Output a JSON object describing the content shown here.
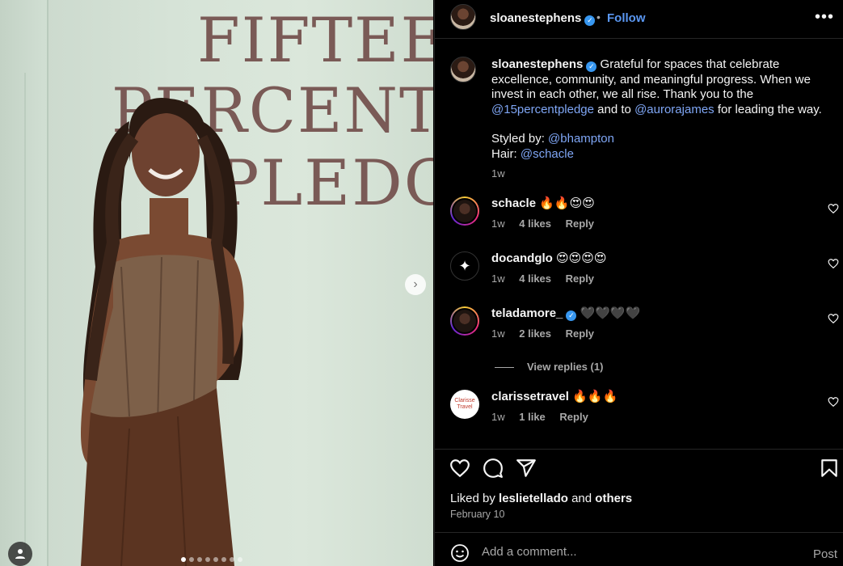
{
  "photo": {
    "sign_lines": [
      "FIFTEEN",
      "PERCENT",
      "PLEDGE"
    ],
    "page_dots_total": 8,
    "page_dots_active": 1
  },
  "header": {
    "username": "sloanestephens",
    "separator": "•",
    "follow_label": "Follow",
    "more_icon": "more-horizontal-icon"
  },
  "caption": {
    "username": "sloanestephens",
    "text_1": "Grateful for spaces that celebrate excellence, community, and meaningful progress. When we invest in each other, we all rise. Thank you to the",
    "mention_1": "@15percentpledge",
    "text_2": "and to",
    "mention_2": "@aurorajames",
    "text_3": "for leading the way.",
    "styled_label": "Styled by:",
    "styled_mention": "@bhampton",
    "hair_label": "Hair:",
    "hair_mention": "@schacle",
    "time": "1w"
  },
  "comments": [
    {
      "username": "schacle",
      "text": "🔥🔥😍😍",
      "time": "1w",
      "likes": "4 likes",
      "reply": "Reply"
    },
    {
      "username": "docandglo",
      "text": "😍😍😍😍",
      "time": "1w",
      "likes": "4 likes",
      "reply": "Reply"
    },
    {
      "username": "teladamore_",
      "text": "🖤🖤🖤🖤",
      "time": "1w",
      "likes": "2 likes",
      "reply": "Reply"
    },
    {
      "username": "clarissetravel",
      "text": "🔥🔥🔥",
      "time": "1w",
      "likes": "1 like",
      "reply": "Reply"
    }
  ],
  "view_replies": "View replies (1)",
  "clarisse_avatar_text": "Clarisse Travel",
  "actions": {
    "liked_prefix": "Liked by",
    "liked_user": "leslietellado",
    "liked_and": "and",
    "liked_others": "others",
    "date": "February 10"
  },
  "add_comment": {
    "placeholder": "Add a comment...",
    "post_label": "Post"
  },
  "colors": {
    "background": "#000000",
    "link": "#7fa6f5",
    "follow": "#5a97f2",
    "verified": "#3797f0",
    "muted": "#a8a8a8"
  }
}
